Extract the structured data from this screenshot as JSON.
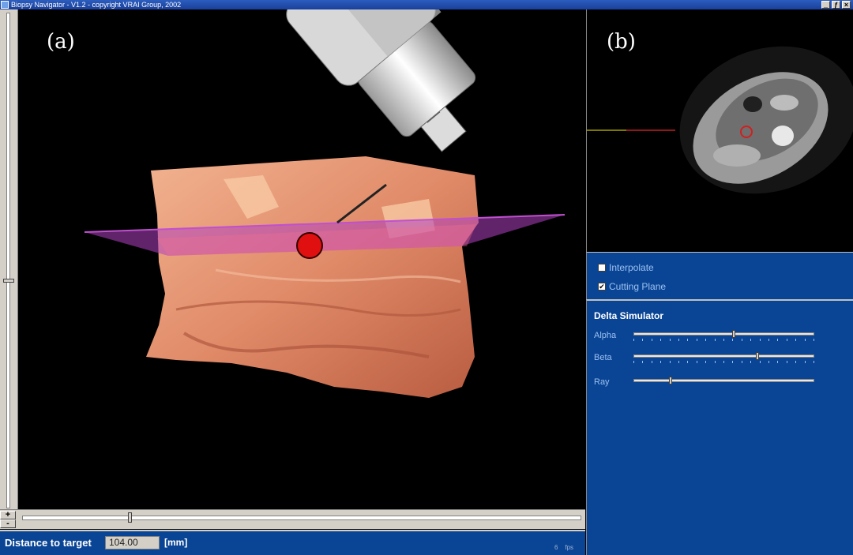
{
  "window": {
    "title": "Biopsy Navigator - V1.2 - copyright VRAI Group, 2002",
    "buttons": [
      "_",
      "ƒ",
      "×"
    ]
  },
  "viewer3d": {
    "label": "(a)"
  },
  "ct_view": {
    "label": "(b)"
  },
  "timeline": {
    "plus_label": "+",
    "minus_label": "-",
    "position": 0.19
  },
  "status": {
    "distance_label": "Distance to target",
    "distance_value": "104.00",
    "unit_label": "[mm]",
    "fps_value": "6",
    "fps_unit": "fps"
  },
  "options": {
    "interpolate": {
      "label": "Interpolate",
      "checked": false
    },
    "cutting_plane": {
      "label": "Cutting Plane",
      "checked": true
    }
  },
  "delta_simulator": {
    "title": "Delta Simulator",
    "sliders": [
      {
        "label": "Alpha",
        "value": 0.55
      },
      {
        "label": "Beta",
        "value": 0.68
      },
      {
        "label": "Ray",
        "value": 0.2
      }
    ]
  },
  "colors": {
    "panel_blue": "#0a4595",
    "target": "#e01010",
    "cutting_plane": "#b040c0",
    "skin": "#e09070"
  }
}
